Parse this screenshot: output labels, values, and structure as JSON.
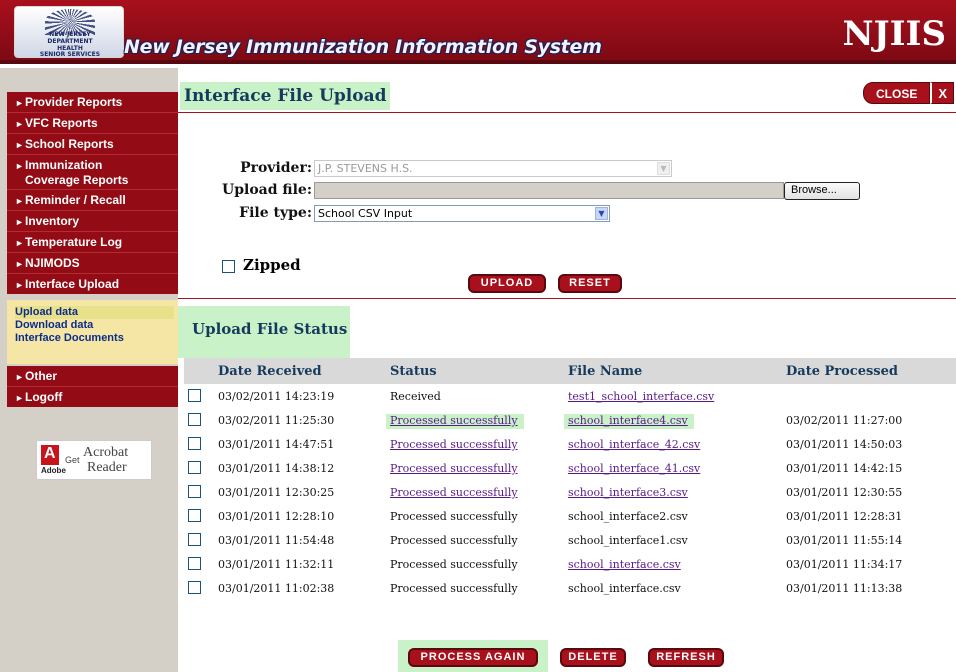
{
  "header": {
    "app_title": "New Jersey Immunization Information System",
    "logo_text": "NJIIS",
    "seal_lines": [
      "NEW JERSEY",
      "DEPARTMENT",
      "HEALTH",
      "SENIOR SERVICES"
    ]
  },
  "sidebar": {
    "items": [
      {
        "label": "Provider Reports"
      },
      {
        "label": "VFC Reports"
      },
      {
        "label": "School Reports"
      },
      {
        "label": "Immunization",
        "label2": "Coverage Reports"
      },
      {
        "label": "Reminder / Recall"
      },
      {
        "label": "Inventory"
      },
      {
        "label": "Temperature Log"
      },
      {
        "label": "NJIMODS"
      },
      {
        "label": "Interface Upload"
      }
    ],
    "sub_items": [
      "Upload data",
      "Download data",
      "Interface Documents"
    ],
    "bottom_items": [
      {
        "label": "Other"
      },
      {
        "label": "Logoff"
      }
    ],
    "arrow": "►",
    "acrobat": {
      "get": "Get",
      "line1": "Acrobat",
      "line2": "Reader",
      "adobe": "Adobe"
    }
  },
  "main": {
    "title": "Interface File Upload",
    "close_label": "CLOSE",
    "close_x": "X",
    "form": {
      "provider_label": "Provider:",
      "provider_value": "J.P. STEVENS H.S.",
      "upload_label": "Upload file:",
      "upload_value": "",
      "browse_label": "Browse...",
      "filetype_label": "File type:",
      "filetype_value": "School CSV Input",
      "zipped_label": "Zipped",
      "upload_button": "UPLOAD",
      "reset_button": "RESET"
    },
    "status_title": "Upload File Status",
    "table": {
      "headers": [
        "Date Received",
        "Status",
        "File Name",
        "Date Processed"
      ],
      "rows": [
        {
          "received": "03/02/2011 14:23:19",
          "status": "Received",
          "file": "test1_school_interface.csv",
          "processed": ""
        },
        {
          "received": "03/02/2011 11:25:30",
          "status": "Processed successfully",
          "file": "school_interface4.csv",
          "processed": "03/02/2011 11:27:00"
        },
        {
          "received": "03/01/2011 14:47:51",
          "status": "Processed successfully",
          "file": "school_interface_42.csv",
          "processed": "03/01/2011 14:50:03"
        },
        {
          "received": "03/01/2011 14:38:12",
          "status": "Processed successfully",
          "file": "school_interface_41.csv",
          "processed": "03/01/2011 14:42:15"
        },
        {
          "received": "03/01/2011 12:30:25",
          "status": "Processed successfully",
          "file": "school_interface3.csv",
          "processed": "03/01/2011 12:30:55"
        },
        {
          "received": "03/01/2011 12:28:10",
          "status": "Processed successfully",
          "file": "school_interface2.csv",
          "processed": "03/01/2011 12:28:31"
        },
        {
          "received": "03/01/2011 11:54:48",
          "status": "Processed successfully",
          "file": "school_interface1.csv",
          "processed": "03/01/2011 11:55:14"
        },
        {
          "received": "03/01/2011 11:32:11",
          "status": "Processed successfully",
          "file": "school_interface.csv",
          "processed": "03/01/2011 11:34:17"
        },
        {
          "received": "03/01/2011 11:02:38",
          "status": "Processed successfully",
          "file": "school_interface.csv",
          "processed": "03/01/2011 11:13:38"
        }
      ]
    },
    "buttons": {
      "process_again": "PROCESS AGAIN",
      "delete": "DELETE",
      "refresh": "REFRESH"
    }
  }
}
